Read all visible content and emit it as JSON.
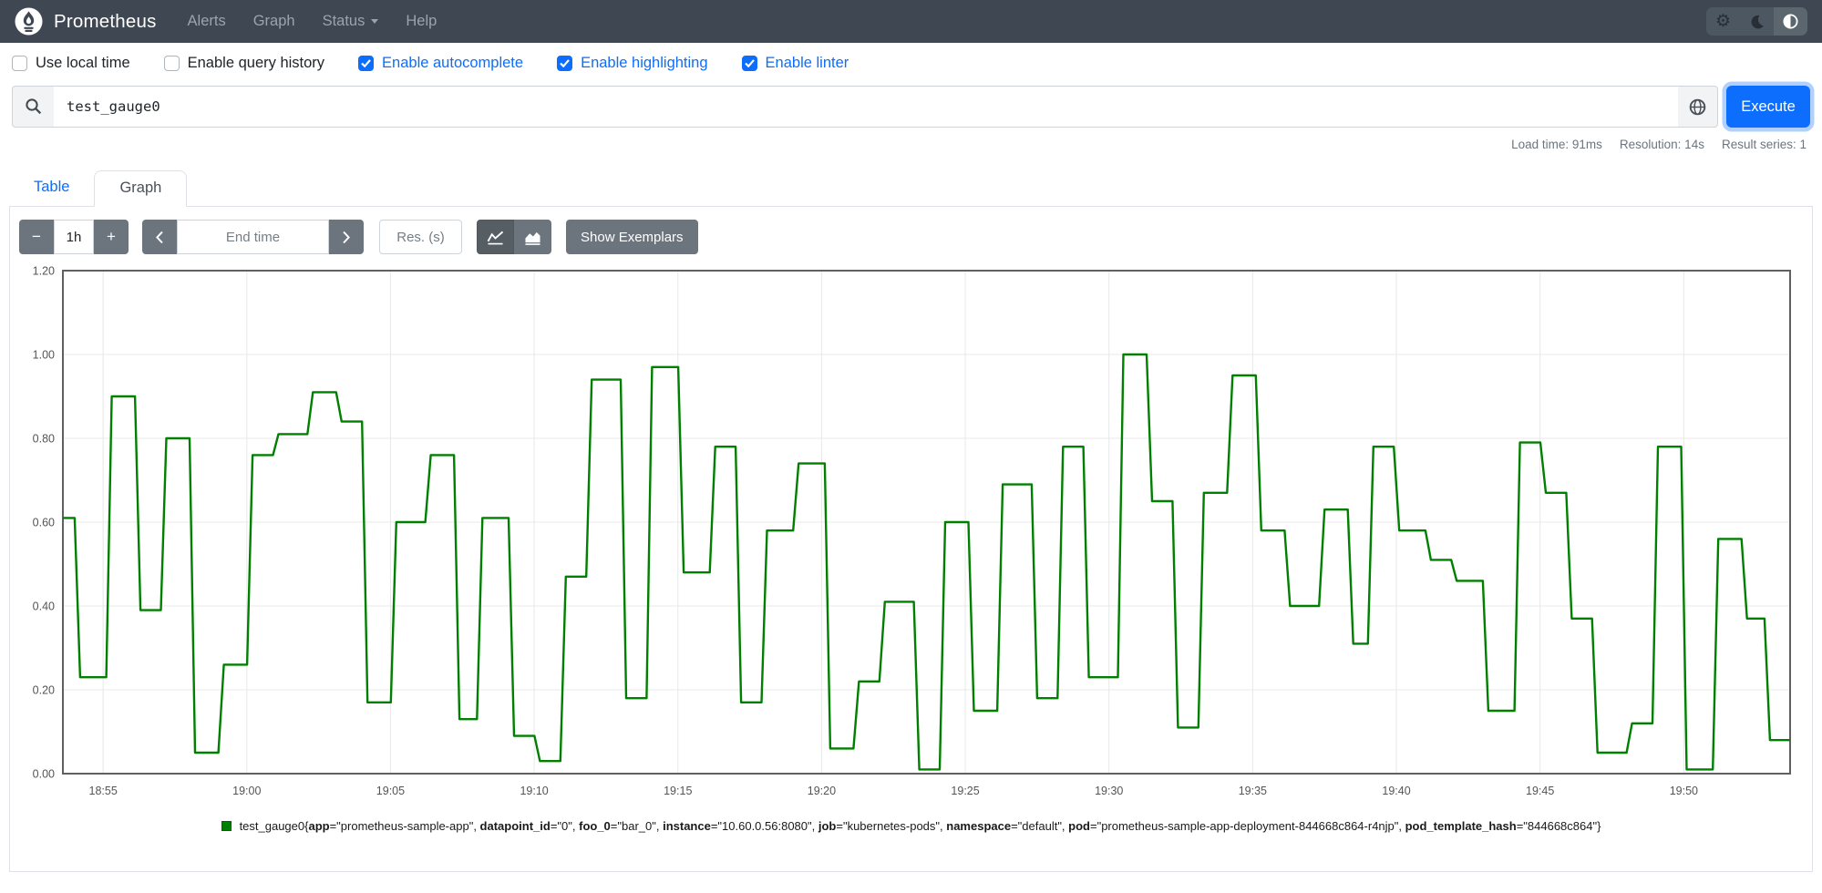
{
  "navbar": {
    "brand": "Prometheus",
    "items": [
      {
        "label": "Alerts"
      },
      {
        "label": "Graph"
      },
      {
        "label": "Status",
        "has_dropdown": true
      },
      {
        "label": "Help"
      }
    ],
    "theme_toggle_icons": [
      "settings-gear",
      "moon",
      "contrast-half"
    ]
  },
  "options": {
    "items": [
      {
        "label": "Use local time",
        "checked": false
      },
      {
        "label": "Enable query history",
        "checked": false
      },
      {
        "label": "Enable autocomplete",
        "checked": true
      },
      {
        "label": "Enable highlighting",
        "checked": true
      },
      {
        "label": "Enable linter",
        "checked": true
      }
    ]
  },
  "query": {
    "value": "test_gauge0",
    "execute_label": "Execute",
    "left_icon": "search",
    "right_icon": "metrics-explorer-globe"
  },
  "stats": {
    "load_time": "Load time: 91ms",
    "resolution": "Resolution: 14s",
    "result_series": "Result series: 1"
  },
  "tabs": [
    {
      "label": "Table",
      "active": false
    },
    {
      "label": "Graph",
      "active": true
    }
  ],
  "graph_controls": {
    "range_decrease": "−",
    "range_value": "1h",
    "range_increase": "+",
    "end_time_placeholder": "End time",
    "res_placeholder": "Res. (s)",
    "chart_type_icons": [
      "line-chart",
      "stacked-chart"
    ],
    "active_chart_type": "line-chart",
    "show_exemplars": "Show Exemplars"
  },
  "legend": {
    "series_name": "test_gauge0",
    "labels": [
      {
        "key": "app",
        "value": "prometheus-sample-app"
      },
      {
        "key": "datapoint_id",
        "value": "0"
      },
      {
        "key": "foo_0",
        "value": "bar_0"
      },
      {
        "key": "instance",
        "value": "10.60.0.56:8080"
      },
      {
        "key": "job",
        "value": "kubernetes-pods"
      },
      {
        "key": "namespace",
        "value": "default"
      },
      {
        "key": "pod",
        "value": "prometheus-sample-app-deployment-844668c864-r4njp"
      },
      {
        "key": "pod_template_hash",
        "value": "844668c864"
      }
    ]
  },
  "chart_data": {
    "type": "line",
    "line_style": "step",
    "title": "",
    "xlabel": "",
    "ylabel": "",
    "grid": true,
    "legend_position": "bottom",
    "ylim": [
      0,
      1.2
    ],
    "y_ticks": [
      "0.00",
      "0.20",
      "0.40",
      "0.60",
      "0.80",
      "1.00",
      "1.20"
    ],
    "x_ticks": [
      "18:55",
      "19:00",
      "19:05",
      "19:10",
      "19:15",
      "19:20",
      "19:25",
      "19:30",
      "19:35",
      "19:40",
      "19:45",
      "19:50"
    ],
    "x_range": [
      "18:53:36",
      "19:53:42"
    ],
    "series": [
      {
        "name": "test_gauge0",
        "color": "#008000",
        "points": [
          [
            "18:53:36",
            0.61
          ],
          [
            "18:54:12",
            0.23
          ],
          [
            "18:55:18",
            0.9
          ],
          [
            "18:56:18",
            0.39
          ],
          [
            "18:57:12",
            0.8
          ],
          [
            "18:58:12",
            0.05
          ],
          [
            "18:59:12",
            0.26
          ],
          [
            "19:00:12",
            0.76
          ],
          [
            "19:01:06",
            0.81
          ],
          [
            "19:02:18",
            0.91
          ],
          [
            "19:03:18",
            0.84
          ],
          [
            "19:04:12",
            0.17
          ],
          [
            "19:05:12",
            0.6
          ],
          [
            "19:06:24",
            0.76
          ],
          [
            "19:07:24",
            0.13
          ],
          [
            "19:08:12",
            0.61
          ],
          [
            "19:09:18",
            0.09
          ],
          [
            "19:10:12",
            0.03
          ],
          [
            "19:11:06",
            0.47
          ],
          [
            "19:12:00",
            0.94
          ],
          [
            "19:13:12",
            0.18
          ],
          [
            "19:14:06",
            0.97
          ],
          [
            "19:15:12",
            0.48
          ],
          [
            "19:16:18",
            0.78
          ],
          [
            "19:17:12",
            0.17
          ],
          [
            "19:18:06",
            0.58
          ],
          [
            "19:19:12",
            0.74
          ],
          [
            "19:20:18",
            0.06
          ],
          [
            "19:21:18",
            0.22
          ],
          [
            "19:22:12",
            0.41
          ],
          [
            "19:23:24",
            0.01
          ],
          [
            "19:24:18",
            0.6
          ],
          [
            "19:25:18",
            0.15
          ],
          [
            "19:26:18",
            0.69
          ],
          [
            "19:27:30",
            0.18
          ],
          [
            "19:28:24",
            0.78
          ],
          [
            "19:29:18",
            0.23
          ],
          [
            "19:30:30",
            1.0
          ],
          [
            "19:31:30",
            0.65
          ],
          [
            "19:32:24",
            0.11
          ],
          [
            "19:33:18",
            0.67
          ],
          [
            "19:34:18",
            0.95
          ],
          [
            "19:35:18",
            0.58
          ],
          [
            "19:36:18",
            0.4
          ],
          [
            "19:37:30",
            0.63
          ],
          [
            "19:38:30",
            0.31
          ],
          [
            "19:39:12",
            0.78
          ],
          [
            "19:40:06",
            0.58
          ],
          [
            "19:41:12",
            0.51
          ],
          [
            "19:42:06",
            0.46
          ],
          [
            "19:43:12",
            0.15
          ],
          [
            "19:44:18",
            0.79
          ],
          [
            "19:45:12",
            0.67
          ],
          [
            "19:46:06",
            0.37
          ],
          [
            "19:47:00",
            0.05
          ],
          [
            "19:48:12",
            0.12
          ],
          [
            "19:49:06",
            0.78
          ],
          [
            "19:50:06",
            0.01
          ],
          [
            "19:51:12",
            0.56
          ],
          [
            "19:52:12",
            0.37
          ],
          [
            "19:53:00",
            0.08
          ]
        ]
      }
    ]
  },
  "colors": {
    "navbar_bg": "#3e4752",
    "accent_blue": "#0d6efd",
    "secondary_gray": "#6c757d",
    "series_green": "#008000",
    "chart_border": "#606060",
    "grid_line": "#e8e8e8"
  }
}
